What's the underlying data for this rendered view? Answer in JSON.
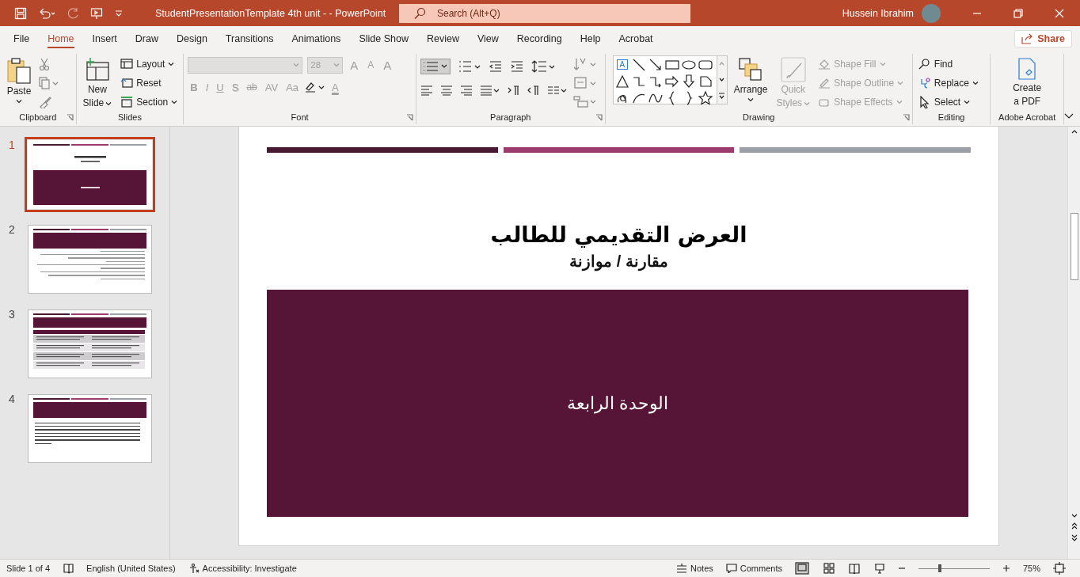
{
  "title_bar": {
    "document_title": "StudentPresentationTemplate 4th unit -  -  PowerPoint",
    "search": {
      "placeholder": "Search (Alt+Q)"
    },
    "user": "Hussein Ibrahim"
  },
  "tabs": [
    {
      "label": "File",
      "selected": false
    },
    {
      "label": "Home",
      "selected": true
    },
    {
      "label": "Insert",
      "selected": false
    },
    {
      "label": "Draw",
      "selected": false
    },
    {
      "label": "Design",
      "selected": false
    },
    {
      "label": "Transitions",
      "selected": false
    },
    {
      "label": "Animations",
      "selected": false
    },
    {
      "label": "Slide Show",
      "selected": false
    },
    {
      "label": "Review",
      "selected": false
    },
    {
      "label": "View",
      "selected": false
    },
    {
      "label": "Recording",
      "selected": false
    },
    {
      "label": "Help",
      "selected": false
    },
    {
      "label": "Acrobat",
      "selected": false
    }
  ],
  "share_button": "Share",
  "ribbon": {
    "clipboard": {
      "label": "Clipboard",
      "paste": "Paste"
    },
    "slides": {
      "label": "Slides",
      "new_slide": [
        "New",
        "Slide"
      ],
      "items": [
        "Layout",
        "Reset",
        "Section"
      ]
    },
    "font": {
      "label": "Font",
      "disabled": true,
      "size": "28",
      "grow_shrink": [
        "A",
        "A"
      ],
      "clear_format": "A",
      "format_buttons": [
        "B",
        "I",
        "U",
        "S",
        "ab",
        "AV",
        "Aa"
      ],
      "font_color": "A"
    },
    "paragraph": {
      "label": "Paragraph"
    },
    "drawing": {
      "label": "Drawing",
      "text_box_glyph": "A",
      "arrange": "Arrange",
      "quick_styles": {
        "label": [
          "Quick",
          "Styles"
        ],
        "disabled": true
      },
      "shape_buttons": [
        {
          "label": "Shape Fill",
          "disabled": true
        },
        {
          "label": "Shape Outline",
          "disabled": true
        },
        {
          "label": "Shape Effects",
          "disabled": true
        }
      ]
    },
    "editing": {
      "label": "Editing",
      "items": [
        "Find",
        "Replace",
        "Select"
      ]
    },
    "acrobat": {
      "label": "Adobe Acrobat",
      "create_pdf": [
        "Create",
        "a PDF"
      ]
    }
  },
  "slides": [
    {
      "number": "1",
      "selected": true,
      "kind": "title"
    },
    {
      "number": "2",
      "selected": false,
      "kind": "bullets"
    },
    {
      "number": "3",
      "selected": false,
      "kind": "table"
    },
    {
      "number": "4",
      "selected": false,
      "kind": "paragraph"
    }
  ],
  "current_slide": {
    "title": "العرض التقديمي للطالب",
    "subtitle": "مقارنة / موازنة",
    "block_text": "الوحدة الرابعة"
  },
  "status_bar": {
    "slide_count": "Slide 1 of 4",
    "language": "English (United States)",
    "accessibility": "Accessibility: Investigate",
    "notes": "Notes",
    "comments": "Comments",
    "zoom": {
      "level": 0.3,
      "reading": "75%"
    }
  }
}
